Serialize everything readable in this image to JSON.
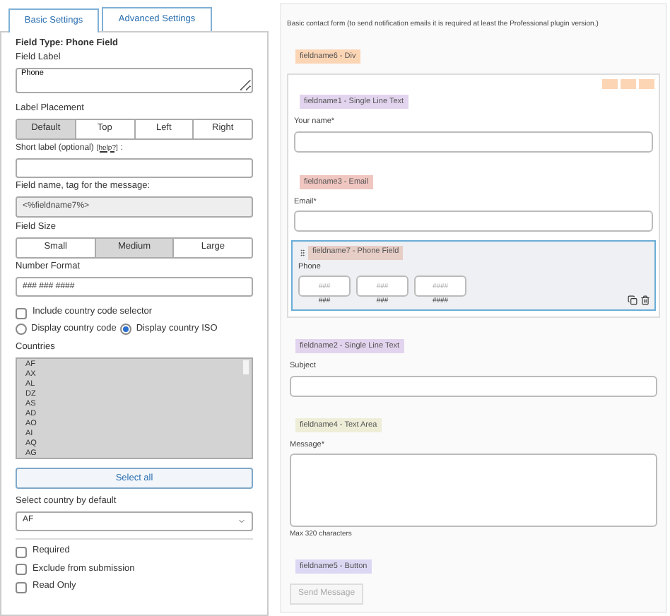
{
  "tabs": [
    {
      "label": "Basic Settings",
      "selected": true
    },
    {
      "label": "Advanced Settings",
      "selected": false
    }
  ],
  "field_type": "Field Type: Phone Field",
  "field_label": {
    "label": "Field Label",
    "value": "Phone"
  },
  "label_placement": {
    "label": "Label Placement",
    "options": [
      {
        "label": "Default",
        "selected": true
      },
      {
        "label": "Top",
        "selected": false
      },
      {
        "label": "Left",
        "selected": false
      },
      {
        "label": "Right",
        "selected": false
      }
    ]
  },
  "short_label": {
    "label": "Short label (optional)",
    "help": "[help?]",
    "suffix": ":"
  },
  "field_name": {
    "label": "Field name, tag for the message:",
    "value": "<%fieldname7%>"
  },
  "field_size": {
    "label": "Field Size",
    "options": [
      {
        "label": "Small",
        "selected": false
      },
      {
        "label": "Medium",
        "selected": true
      },
      {
        "label": "Large",
        "selected": false
      }
    ]
  },
  "number_format": {
    "label": "Number Format",
    "value": "### ### ####"
  },
  "include_country_code": {
    "label": "Include country code selector",
    "checked": false
  },
  "display_options": [
    {
      "label": "Display country code",
      "selected": false
    },
    {
      "label": "Display country ISO",
      "selected": true
    }
  ],
  "countries": {
    "label": "Countries",
    "options": [
      "AF",
      "AX",
      "AL",
      "DZ",
      "AS",
      "AD",
      "AO",
      "AI",
      "AQ",
      "AG"
    ]
  },
  "select_all": "Select all",
  "default_country": {
    "label": "Select country by default",
    "value": "AF"
  },
  "flags": [
    {
      "label": "Required",
      "checked": false
    },
    {
      "label": "Exclude from submission",
      "checked": false
    },
    {
      "label": "Read Only",
      "checked": false
    }
  ],
  "form": {
    "intro": "Basic contact form (to send notification emails it is required at least the Professional plugin version.)",
    "items": [
      {
        "kind": "div",
        "tag": "fieldname6 - Div",
        "color": "#fcd5b5",
        "children": [
          {
            "kind": "text",
            "tag": "fieldname1 - Single Line Text",
            "color": "#e2d4ee",
            "label": "Your name*",
            "selected": false
          },
          {
            "kind": "text",
            "tag": "fieldname3 - Email",
            "color": "#f0c6c0",
            "label": "Email*",
            "selected": false
          },
          {
            "kind": "phone",
            "tag": "fieldname7 - Phone Field",
            "color": "#e6cdc6",
            "label": "Phone",
            "selected": true,
            "parts": [
              {
                "placeholder": "###",
                "hint": "###"
              },
              {
                "placeholder": "###",
                "hint": "###"
              },
              {
                "placeholder": "####",
                "hint": "####"
              }
            ]
          }
        ]
      },
      {
        "kind": "text",
        "tag": "fieldname2 - Single Line Text",
        "color": "#e2d4ee",
        "label": "Subject",
        "selected": false
      },
      {
        "kind": "textarea",
        "tag": "fieldname4 - Text Area",
        "color": "#eeeed8",
        "label": "Message*",
        "note": "Max 320 characters",
        "selected": false
      },
      {
        "kind": "button",
        "tag": "fieldname5 - Button",
        "color": "#dcd8f4",
        "label": "Send Message",
        "selected": false
      }
    ]
  }
}
